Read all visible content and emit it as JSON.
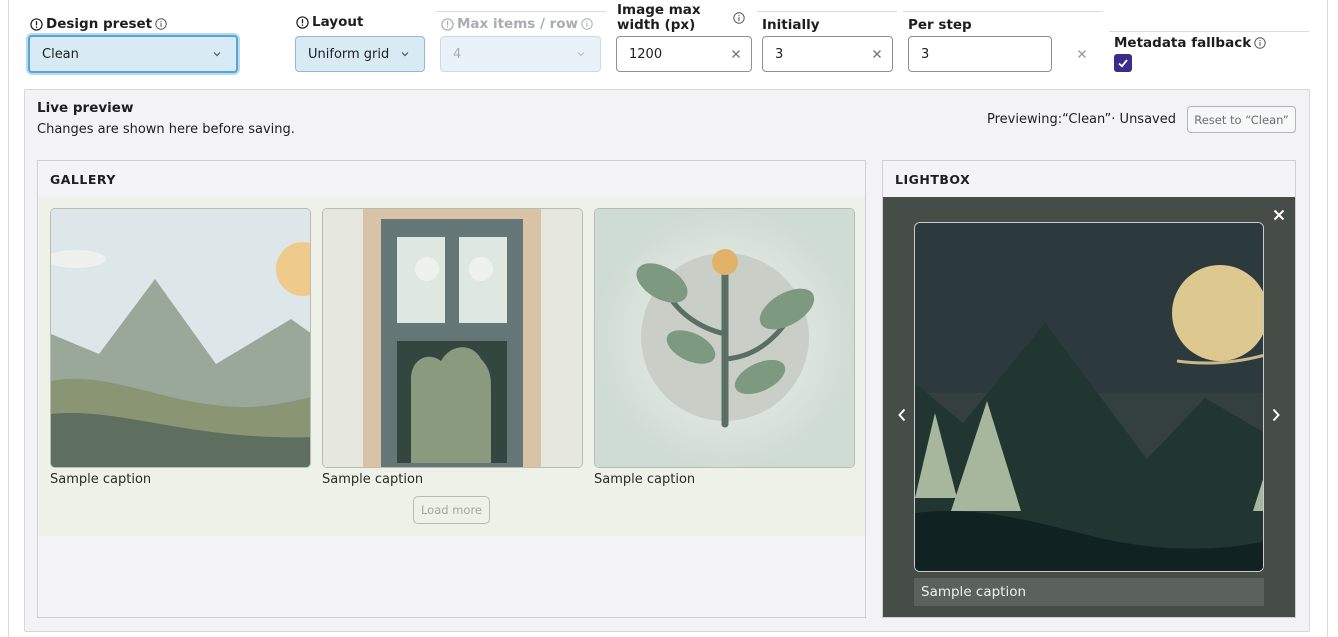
{
  "settings": {
    "design_preset": {
      "label": "Design preset",
      "value": "Clean"
    },
    "layout": {
      "label": "Layout",
      "value": "Uniform grid"
    },
    "max_items": {
      "label": "Max items / row",
      "value": "4"
    },
    "image_max_width": {
      "label_line1": "Image max",
      "label_line2": "width (px)",
      "value": "1200"
    },
    "initially": {
      "label": "Initially",
      "value": "3"
    },
    "per_step": {
      "label": "Per step",
      "value": "3"
    },
    "metadata_fallback": {
      "label": "Metadata fallback",
      "checked": true
    }
  },
  "preview": {
    "title": "Live preview",
    "subtitle": "Changes are shown here before saving.",
    "status": "Previewing:“Clean”· Unsaved",
    "reset_label": "Reset to “Clean”"
  },
  "gallery": {
    "title": "GALLERY",
    "items": [
      {
        "caption": "Sample caption",
        "image": "mountain-landscape"
      },
      {
        "caption": "Sample caption",
        "image": "doorway"
      },
      {
        "caption": "Sample caption",
        "image": "plant-sprig"
      }
    ],
    "load_more_label": "Load more"
  },
  "lightbox": {
    "title": "LIGHTBOX",
    "caption": "Sample caption",
    "image": "night-mountains"
  },
  "colors": {
    "accent_checkbox": "#3c2c8a",
    "select_bg": "#d8ebf5",
    "lightbox_bg": "#464c46",
    "gallery_bg": "#eef1e8"
  },
  "icons": [
    "warning-icon",
    "info-icon",
    "chevron-down-icon",
    "clear-icon",
    "check-icon",
    "close-icon",
    "chevron-left-icon",
    "chevron-right-icon"
  ]
}
